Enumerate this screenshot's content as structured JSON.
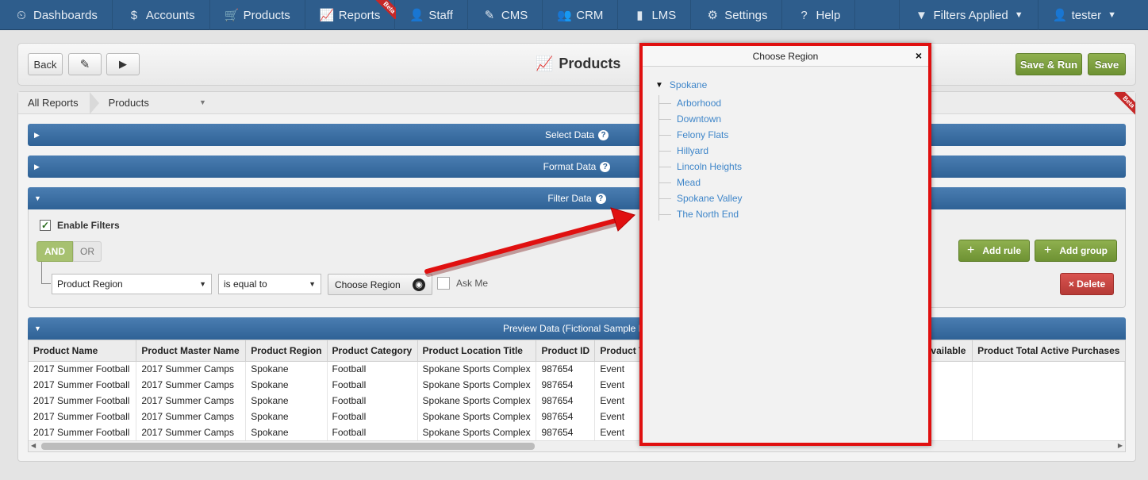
{
  "nav": {
    "items": [
      {
        "label": "Dashboards",
        "icon": "⏲"
      },
      {
        "label": "Accounts",
        "icon": "$"
      },
      {
        "label": "Products",
        "icon": "🛒"
      },
      {
        "label": "Reports",
        "icon": "📈",
        "badge": "Beta"
      },
      {
        "label": "Staff",
        "icon": "👤"
      },
      {
        "label": "CMS",
        "icon": "✎"
      },
      {
        "label": "CRM",
        "icon": "👥"
      },
      {
        "label": "LMS",
        "icon": "▮"
      },
      {
        "label": "Settings",
        "icon": "⚙"
      },
      {
        "label": "Help",
        "icon": "?"
      }
    ],
    "filters": "Filters Applied",
    "user": "tester"
  },
  "toolbar": {
    "back": "Back",
    "title": "Products",
    "save_run": "Save & Run",
    "save": "Save"
  },
  "breadcrumb": {
    "root": "All Reports",
    "current": "Products",
    "badge": "Beta"
  },
  "sections": {
    "select": "Select Data",
    "format": "Format Data",
    "filter": "Filter Data",
    "preview": "Preview Data (Fictional Sample Da"
  },
  "filter": {
    "enable": "Enable Filters",
    "and": "AND",
    "or": "OR",
    "field": "Product Region",
    "operator": "is equal to",
    "value_button": "Choose Region",
    "ask_me": "Ask Me",
    "add_rule": "Add rule",
    "add_group": "Add group",
    "delete": "× Delete"
  },
  "table": {
    "columns": [
      "Product Name",
      "Product Master Name",
      "Product Region",
      "Product Category",
      "Product Location Title",
      "Product ID",
      "Product T"
    ],
    "hidden_columns": [
      "Available",
      "Product Total Active Purchases"
    ],
    "rows": [
      [
        "2017 Summer Football",
        "2017 Summer Camps",
        "Spokane",
        "Football",
        "Spokane Sports Complex",
        "987654",
        "Event"
      ],
      [
        "2017 Summer Football",
        "2017 Summer Camps",
        "Spokane",
        "Football",
        "Spokane Sports Complex",
        "987654",
        "Event"
      ],
      [
        "2017 Summer Football",
        "2017 Summer Camps",
        "Spokane",
        "Football",
        "Spokane Sports Complex",
        "987654",
        "Event"
      ],
      [
        "2017 Summer Football",
        "2017 Summer Camps",
        "Spokane",
        "Football",
        "Spokane Sports Complex",
        "987654",
        "Event"
      ],
      [
        "2017 Summer Football",
        "2017 Summer Camps",
        "Spokane",
        "Football",
        "Spokane Sports Complex",
        "987654",
        "Event"
      ]
    ]
  },
  "modal": {
    "title": "Choose Region",
    "close": "×",
    "root": "Spokane",
    "children": [
      "Arborhood",
      "Downtown",
      "Felony Flats",
      "Hillyard",
      "Lincoln Heights",
      "Mead",
      "Spokane Valley",
      "The North End"
    ]
  },
  "colors": {
    "nav": "#2e5d8c",
    "section": "#2f6296",
    "green": "#7a9c3c",
    "red_highlight": "#e01010",
    "link": "#3f86c9"
  }
}
